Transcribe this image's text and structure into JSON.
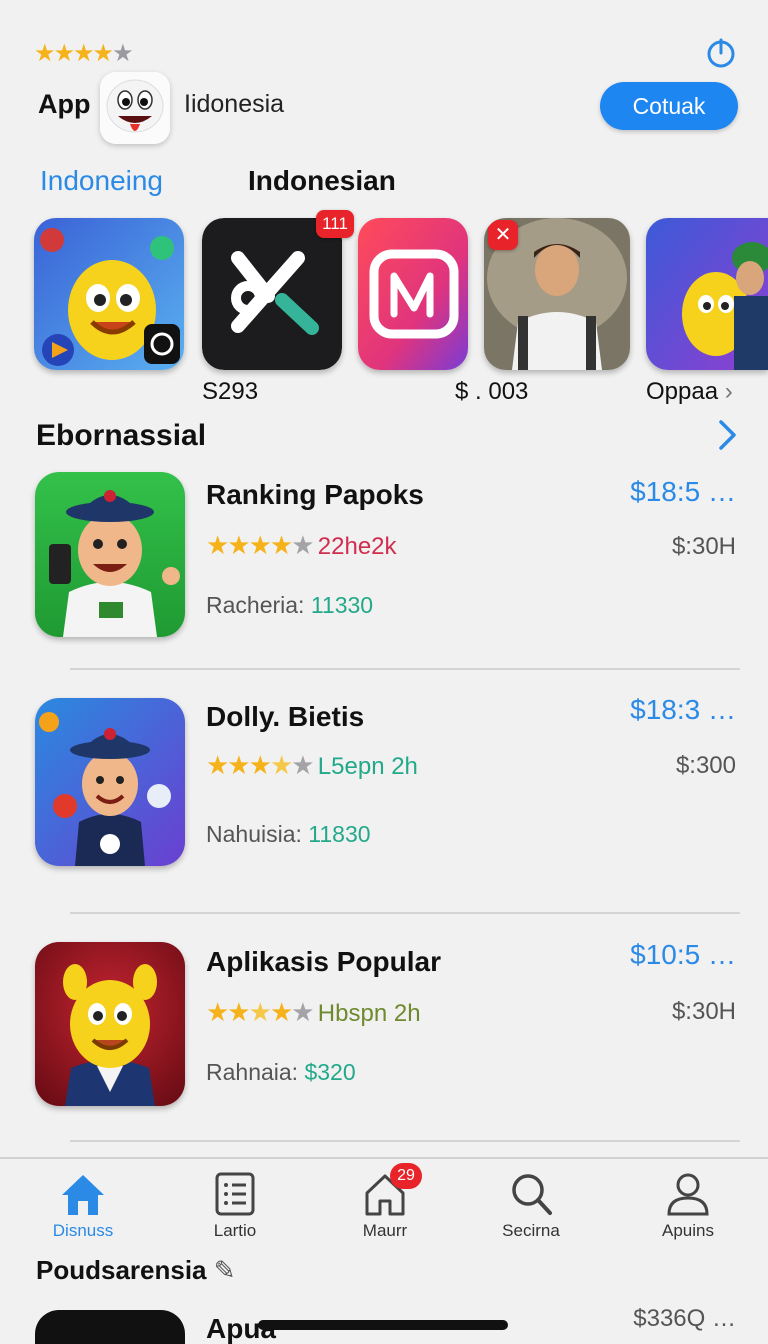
{
  "header": {
    "app_label": "App",
    "country": "Iidonesia",
    "button_label": "Cotuak",
    "rating_stars": 4
  },
  "tabs": [
    "Indoneing",
    "Indonesian"
  ],
  "featured": {
    "badge_count": "111",
    "prices": [
      "S293",
      "$ . 003",
      "Oppaa"
    ]
  },
  "section": {
    "title": "Ebornassial"
  },
  "apps": [
    {
      "name": "Ranking Papoks",
      "rating": 4.5,
      "rating_text": "22he2k",
      "rating_color": "#d12d4f",
      "sub_label": "Racheria:",
      "sub_value": "11330",
      "price": "$18:5 …",
      "secondary": "$:30H"
    },
    {
      "name": "Dolly. Bietis",
      "rating": 3.5,
      "rating_text": "L5epn 2h",
      "rating_color": "#23a98a",
      "sub_label": "Nahuisia:",
      "sub_value": "11830",
      "price": "$18:3 …",
      "secondary": "$:300"
    },
    {
      "name": "Aplikasis Popular",
      "rating": 3.5,
      "rating_text": "Hbspn 2h",
      "rating_color": "#6f8a2e",
      "sub_label": "Rahnaia:",
      "sub_value": "$320",
      "price": "$10:5 …",
      "secondary": "$:30H"
    }
  ],
  "tabbar": {
    "items": [
      "Disnuss",
      "Lartio",
      "Maurr",
      "Secirna",
      "Apuins"
    ],
    "badge": "29"
  },
  "bottom": {
    "title": "Poudsarensia",
    "app_name": "Apua",
    "price": "$336Q …"
  },
  "colors": {
    "accent": "#2b8ae6",
    "badge": "#e8242a",
    "star": "#f5b21b"
  }
}
